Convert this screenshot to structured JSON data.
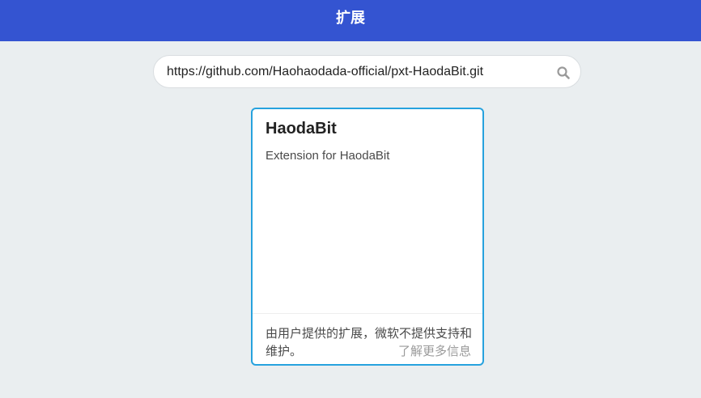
{
  "header": {
    "title": "扩展"
  },
  "search": {
    "value": "https://github.com/Haohaodada-official/pxt-HaodaBit.git",
    "icon": "search-icon"
  },
  "card": {
    "title": "HaodaBit",
    "description": "Extension for HaodaBit",
    "footer_text": "由用户提供的扩展，微软不提供支持和维护。",
    "learn_more": "了解更多信息"
  },
  "colors": {
    "header_bg": "#3454d1",
    "page_bg": "#eaeef0",
    "card_border": "#27a2de"
  }
}
